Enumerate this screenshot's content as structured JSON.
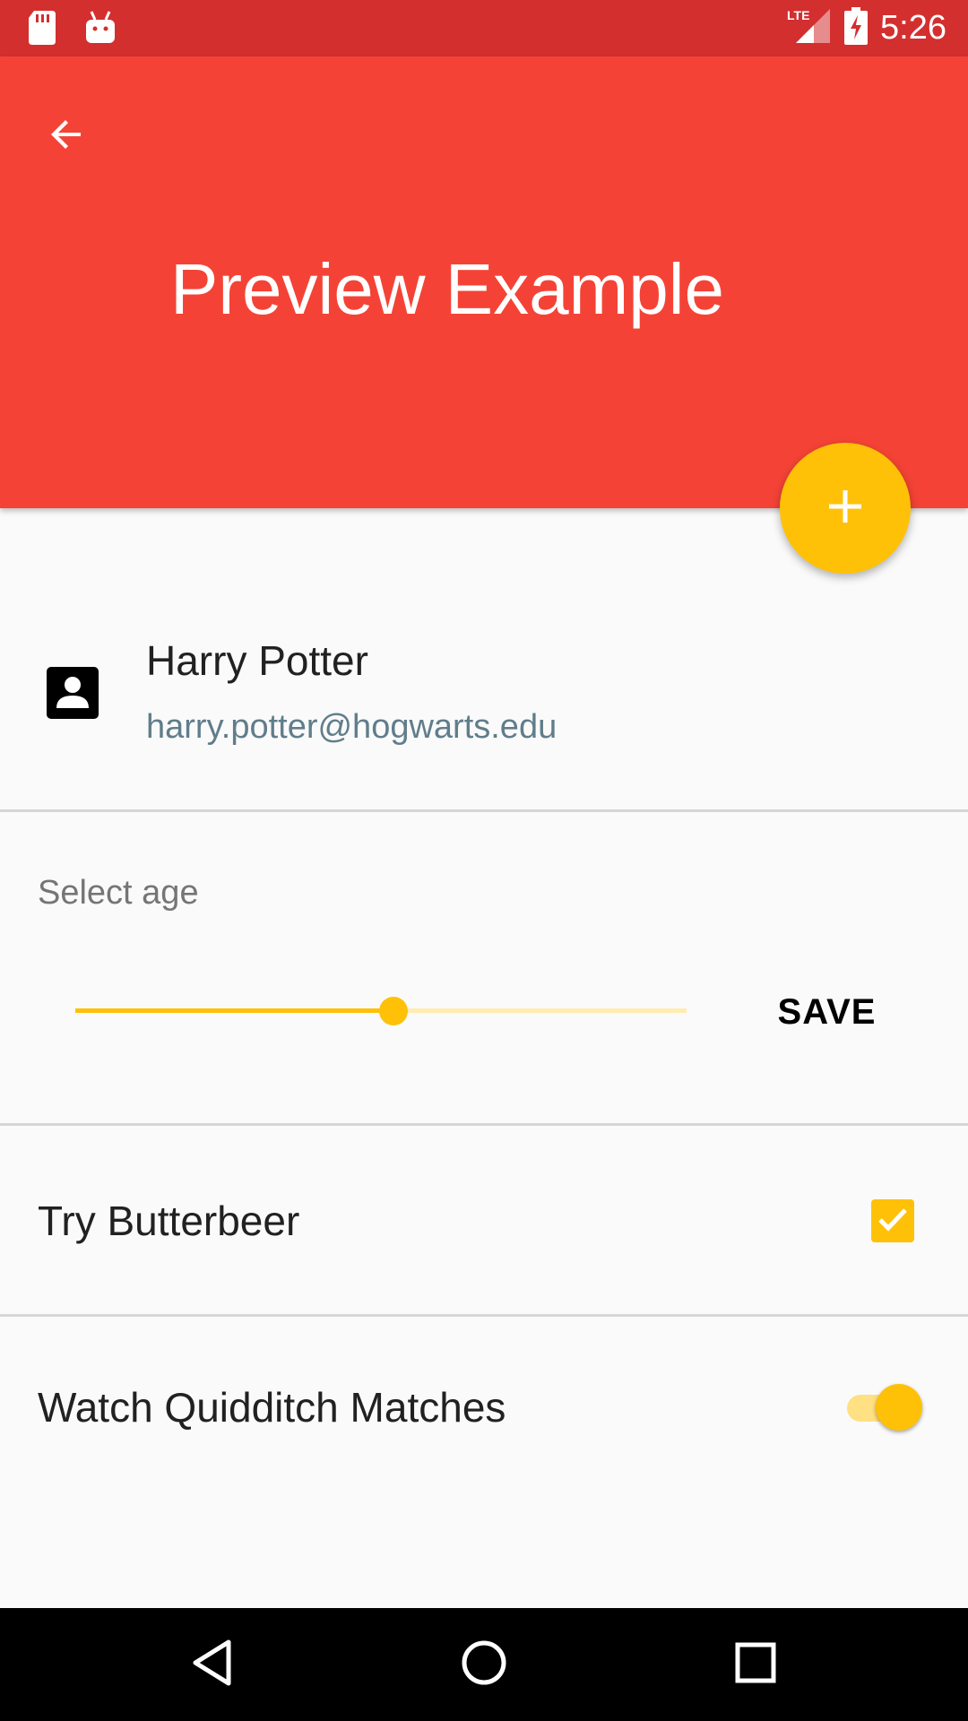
{
  "status_bar": {
    "time": "5:26",
    "network": "LTE",
    "icons": [
      "sd-card-icon",
      "android-icon",
      "lte-signal-icon",
      "battery-charging-icon"
    ]
  },
  "app_bar": {
    "title": "Preview Example",
    "back_icon": "arrow-back-icon",
    "fab_icon": "plus-icon",
    "color": "#f44336",
    "status_color": "#d32f2f"
  },
  "contact": {
    "name": "Harry Potter",
    "email": "harry.potter@hogwarts.edu",
    "icon": "contact-card-icon"
  },
  "age": {
    "label": "Select age",
    "slider_fraction": 0.52,
    "save_label": "SAVE"
  },
  "options": {
    "butterbeer_label": "Try Butterbeer",
    "butterbeer_checked": true,
    "quidditch_label": "Watch Quidditch Matches",
    "quidditch_on": true
  },
  "accent_color": "#ffc107",
  "nav_bar": {
    "icons": [
      "back-triangle-icon",
      "home-circle-icon",
      "recents-square-icon"
    ]
  }
}
